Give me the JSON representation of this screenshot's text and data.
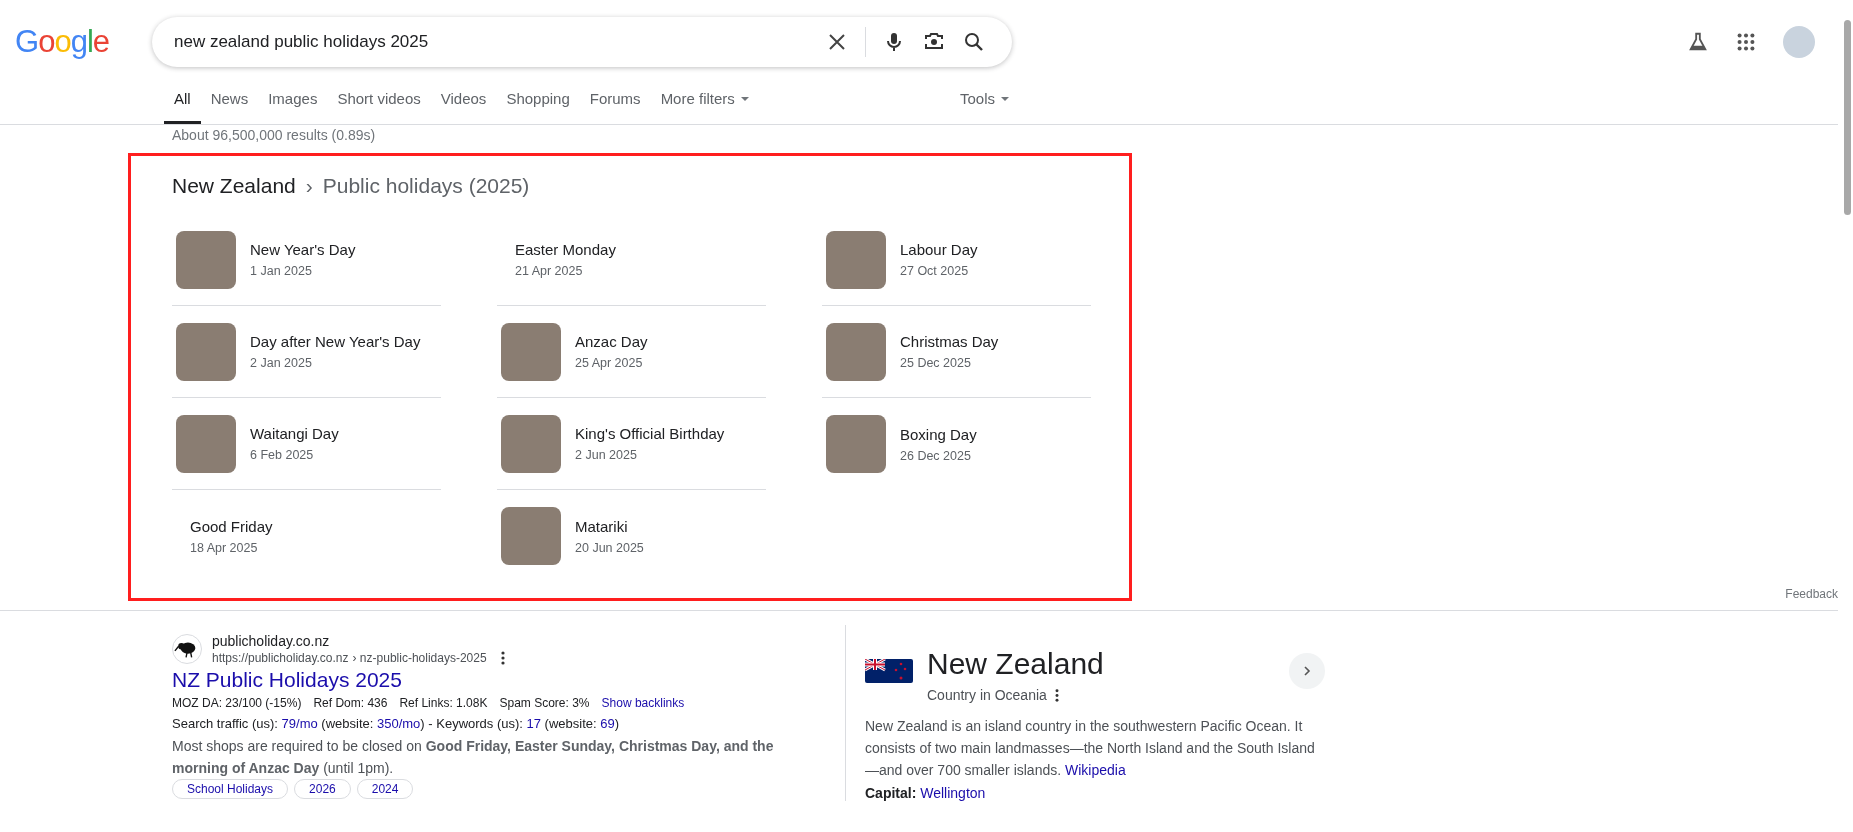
{
  "logo": {
    "letters": [
      {
        "text": "G",
        "color": "#4285f4"
      },
      {
        "text": "o",
        "color": "#ea4335"
      },
      {
        "text": "o",
        "color": "#fbbc05"
      },
      {
        "text": "g",
        "color": "#4285f4"
      },
      {
        "text": "l",
        "color": "#34a853"
      },
      {
        "text": "e",
        "color": "#ea4335"
      }
    ]
  },
  "search": {
    "value": "new zealand public holidays 2025"
  },
  "tabs": [
    {
      "label": "All",
      "selected": true,
      "dropdown": false
    },
    {
      "label": "News",
      "selected": false,
      "dropdown": false
    },
    {
      "label": "Images",
      "selected": false,
      "dropdown": false
    },
    {
      "label": "Short videos",
      "selected": false,
      "dropdown": false
    },
    {
      "label": "Videos",
      "selected": false,
      "dropdown": false
    },
    {
      "label": "Shopping",
      "selected": false,
      "dropdown": false
    },
    {
      "label": "Forums",
      "selected": false,
      "dropdown": false
    },
    {
      "label": "More filters",
      "selected": false,
      "dropdown": true
    }
  ],
  "tools": {
    "label": "Tools"
  },
  "result_stats": "About 96,500,000 results (0.89s)",
  "holidays_card": {
    "breadcrumb": [
      "New Zealand",
      "›",
      "Public holidays (2025)"
    ],
    "columns": [
      [
        {
          "name": "New Year's Day",
          "date": "1 Jan 2025",
          "has_image": true
        },
        {
          "name": "Day after New Year's Day",
          "date": "2 Jan 2025",
          "has_image": true
        },
        {
          "name": "Waitangi Day",
          "date": "6 Feb 2025",
          "has_image": true
        },
        {
          "name": "Good Friday",
          "date": "18 Apr 2025",
          "has_image": false
        }
      ],
      [
        {
          "name": "Easter Monday",
          "date": "21 Apr 2025",
          "has_image": false
        },
        {
          "name": "Anzac Day",
          "date": "25 Apr 2025",
          "has_image": true
        },
        {
          "name": "King's Official Birthday",
          "date": "2 Jun 2025",
          "has_image": true
        },
        {
          "name": "Matariki",
          "date": "20 Jun 2025",
          "has_image": true
        }
      ],
      [
        {
          "name": "Labour Day",
          "date": "27 Oct 2025",
          "has_image": true
        },
        {
          "name": "Christmas Day",
          "date": "25 Dec 2025",
          "has_image": true
        },
        {
          "name": "Boxing Day",
          "date": "26 Dec 2025",
          "has_image": true
        }
      ]
    ]
  },
  "feedback": "Feedback",
  "result": {
    "site": "publicholiday.co.nz",
    "url": "https://publicholiday.co.nz",
    "path": "› nz-public-holidays-2025",
    "title": "NZ Public Holidays 2025",
    "metrics": [
      "MOZ DA: 23/100 (-15%)",
      "Ref Dom: 436",
      "Ref Links: 1.08K",
      "Spam Score: 3%"
    ],
    "backlinks": "Show backlinks",
    "traffic": [
      {
        "text": "Search traffic (us): ",
        "value": false
      },
      {
        "text": "79/mo",
        "value": true
      },
      {
        "text": " (website: ",
        "value": false
      },
      {
        "text": "350/mo",
        "value": true
      },
      {
        "text": ") - Keywords (us): ",
        "value": false
      },
      {
        "text": "17",
        "value": true
      },
      {
        "text": " (website: ",
        "value": false
      },
      {
        "text": "69",
        "value": true
      },
      {
        "text": ")",
        "value": false
      }
    ],
    "snippet": "Most shops are required to be closed on **Good Friday, Easter Sunday, Christmas Day, and the morning of Anzac Day** (until 1pm).",
    "chips": [
      "School Holidays",
      "2026",
      "2024"
    ]
  },
  "knowledge_panel": {
    "title": "New Zealand",
    "subtitle": "Country in Oceania",
    "description": "New Zealand is an island country in the southwestern Pacific Ocean. It consists of two main landmasses—the North Island and the South Island—and over 700 smaller islands.",
    "source": "Wikipedia",
    "facts": [
      {
        "label": "Capital:",
        "value": "Wellington"
      }
    ]
  }
}
